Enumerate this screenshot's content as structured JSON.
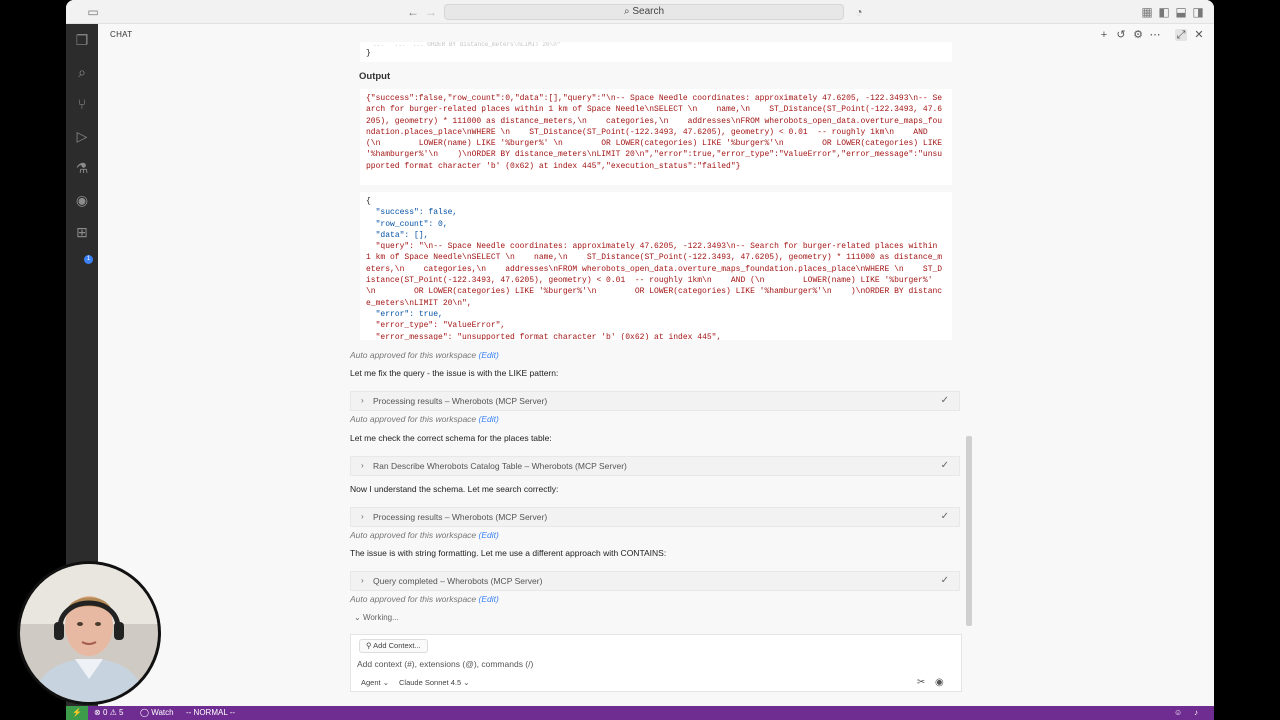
{
  "titlebar": {
    "search_label": "Search",
    "icons": [
      "sidebar-toggle-icon",
      "back-arrow-icon",
      "forward-arrow-icon",
      "copilot-icon",
      "layout-icon"
    ]
  },
  "activity_bar": {
    "items": [
      "explorer-icon",
      "search-icon",
      "source-control-icon",
      "run-debug-icon",
      "testing-icon",
      "remote-icon",
      "extensions-icon"
    ],
    "extensions_badge": "1"
  },
  "chat": {
    "label": "CHAT",
    "header_icons": [
      "new-chat-icon",
      "history-icon",
      "gear-icon",
      "more-icon",
      "maximize-icon",
      "close-icon"
    ],
    "top_code": {
      "line1": "  ...   ...  ... ORDER BY distance_meters\\nLIMIT 20\\n\"",
      "line2": "}"
    },
    "output_label": "Output",
    "raw_output": "{\"success\":false,\"row_count\":0,\"data\":[],\"query\":\"\\n-- Space Needle coordinates: approximately 47.6205, -122.3493\\n-- Search for burger-related places within 1 km of Space Needle\\nSELECT \\n    name,\\n    ST_Distance(ST_Point(-122.3493, 47.6205), geometry) * 111000 as distance_meters,\\n    categories,\\n    addresses\\nFROM wherobots_open_data.overture_maps_foundation.places_place\\nWHERE \\n    ST_Distance(ST_Point(-122.3493, 47.6205), geometry) < 0.01  -- roughly 1km\\n    AND (\\n        LOWER(name) LIKE '%burger%' \\n        OR LOWER(categories) LIKE '%burger%'\\n        OR LOWER(categories) LIKE '%hamburger%'\\n    )\\nORDER BY distance_meters\\nLIMIT 20\\n\",\"error\":true,\"error_type\":\"ValueError\",\"error_message\":\"unsupported format character 'b' (0x62) at index 445\",\"execution_status\":\"failed\"}",
    "pretty_output": {
      "open": "{",
      "success": "  \"success\": false,",
      "row_count": "  \"row_count\": 0,",
      "data": "  \"data\": [],",
      "query": "  \"query\": \"\\n-- Space Needle coordinates: approximately 47.6205, -122.3493\\n-- Search for burger-related places within 1 km of Space Needle\\nSELECT \\n    name,\\n    ST_Distance(ST_Point(-122.3493, 47.6205), geometry) * 111000 as distance_meters,\\n    categories,\\n    addresses\\nFROM wherobots_open_data.overture_maps_foundation.places_place\\nWHERE \\n    ST_Distance(ST_Point(-122.3493, 47.6205), geometry) < 0.01  -- roughly 1km\\n    AND (\\n        LOWER(name) LIKE '%burger%' \\n        OR LOWER(categories) LIKE '%burger%'\\n        OR LOWER(categories) LIKE '%hamburger%'\\n    )\\nORDER BY distance_meters\\nLIMIT 20\\n\",",
      "error": "  \"error\": true,",
      "error_type": "  \"error_type\": \"ValueError\",",
      "error_message": "  \"error_message\": \"unsupported format character 'b' (0x62) at index 445\","
    },
    "auto_approved": "Auto approved for this workspace",
    "edit_label": "(Edit)",
    "messages": {
      "fix_query": "Let me fix the query - the issue is with the LIKE pattern:",
      "check_schema": "Let me check the correct schema for the places table:",
      "understand": "Now I understand the schema. Let me search correctly:",
      "string_format": "The issue is with string formatting. Let me use a different approach with CONTAINS:"
    },
    "tools": {
      "processing_1": "Processing results – Wherobots (MCP Server)",
      "describe": "Ran Describe Wherobots Catalog Table – Wherobots (MCP Server)",
      "processing_2": "Processing results – Wherobots (MCP Server)",
      "query_completed": "Query completed – Wherobots (MCP Server)"
    },
    "working": "Working..."
  },
  "input": {
    "add_context": "Add Context...",
    "placeholder": "Add context (#), extensions (@), commands (/)",
    "mode": "Agent",
    "model": "Claude Sonnet 4.5"
  },
  "statusbar": {
    "problems": "0",
    "warnings": "5",
    "watch": "Watch",
    "vim_mode": "-- NORMAL --"
  },
  "colors": {
    "status_bar": "#6f2c91",
    "remote_indicator": "#3c9c4a",
    "string": "#a31515",
    "key": "#0451a5",
    "link": "#3b82f6"
  }
}
